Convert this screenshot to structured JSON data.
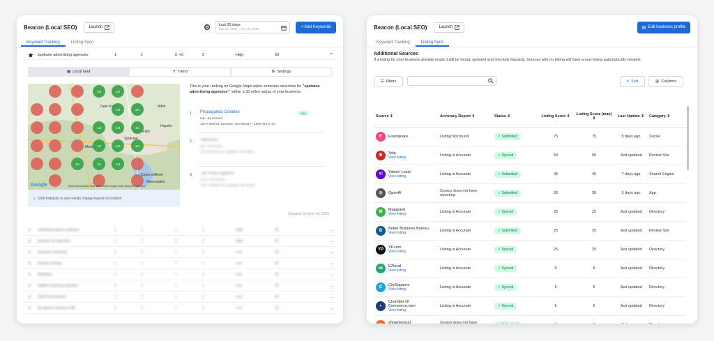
{
  "left": {
    "app_title": "Beacon (Local SEO)",
    "launch_label": "Launch",
    "date_range": "Last 30 days",
    "date_sub": "Sep 23, 2025 – Oct 23, 2025",
    "add_keywords_label": "+ Add Keywords",
    "tabs": [
      "Keyword Tracking",
      "Listing Sync"
    ],
    "keyword": {
      "name": "spokane advertising agencies",
      "c1": "1",
      "c2": "1",
      "c3": "5",
      "c3_change": "3",
      "c4": "2",
      "difficulty": "High",
      "volume": "90"
    },
    "map_tabs": [
      "Local Grid",
      "Trend",
      "Settings"
    ],
    "map": {
      "places": [
        "Deer Park",
        "Athol",
        "Hayden",
        "Post Falls",
        "Medical Lake",
        "Spokane",
        "Coeur d'Alene",
        "Reservation"
      ],
      "pin_label": "1st",
      "footer_text": "Click hotspots to see results change based on location",
      "attribution": "Keyboard shortcuts   Map data ©2025 Google   Terms   Report a map error"
    },
    "rank_description_pre": "This is your ranking on Google Maps when someone searches for ",
    "rank_description_keyword": "\"spokane advertising agencies\"",
    "rank_description_post": ", within a 30 miles radius of your business.",
    "results": [
      {
        "num": "1",
        "name": "Propaganda Creative",
        "rating": "5★ • 64 reviews",
        "address": "123 S Wall St, Spokane, WA 99201 • +1509-413-1719",
        "you": "You"
      },
      {
        "num": "2",
        "name": "Oblivision",
        "rating": "5★ • 42 reviews",
        "address": "721 N Monroe St, Spokane, WA 99201",
        "you": ""
      },
      {
        "num": "3",
        "name": "Tall Grass Agency",
        "rating": "4.9★ • 18 reviews",
        "address": "155 S Madison St, Spokane, WA 99201",
        "you": ""
      }
    ],
    "updated_text": "Updated October 18, 2025",
    "other_keywords": [
      {
        "name": "marketing agency spokane",
        "c1": "1",
        "c2": "1",
        "c3": "1",
        "c4": "1",
        "d": "High",
        "v": "90"
      },
      {
        "name": "spokane ad agencies",
        "c1": "1",
        "c2": "1",
        "c3": "4",
        "c4": "2",
        "d": "High",
        "v": "50"
      },
      {
        "name": "spokane marketing",
        "c1": "1",
        "c2": "1",
        "c3": "1",
        "c4": "1",
        "d": "Low",
        "v": "30"
      },
      {
        "name": "Graphic Design",
        "c1": "1",
        "c2": "1",
        "c3": "1",
        "c4": "1",
        "d": "Low",
        "v": "30"
      },
      {
        "name": "Branding",
        "c1": "1",
        "c2": "1",
        "c3": "1",
        "c4": "1",
        "d": "Low",
        "v": "30"
      },
      {
        "name": "Digital marketing Spokane",
        "c1": "4",
        "c2": "1",
        "c3": "1",
        "c4": "1",
        "d": "Low",
        "v": "30"
      },
      {
        "name": "Web Development",
        "c1": "1",
        "c2": "1",
        "c3": "1",
        "c4": "1",
        "d": "Low",
        "v": "30"
      },
      {
        "name": "Ad agency Spokane WA",
        "c1": "1",
        "c2": "1",
        "c3": "1",
        "c4": "1",
        "d": "Low",
        "v": "30"
      }
    ]
  },
  "right": {
    "app_title": "Beacon (Local SEO)",
    "launch_label": "Launch",
    "edit_profile_label": "Edit business profile",
    "tabs": [
      "Keyword Tracking",
      "Listing Sync"
    ],
    "section_title": "Additional Sources",
    "section_desc": "If a listing for your business already exists it will be found, updated and checked regularly. Sources with no listing will have a new listing automatically created.",
    "filters_label": "Filters",
    "search_placeholder": "",
    "sort_label": "Sort",
    "columns_label": "Columns",
    "headers": [
      "Source",
      "Accuracy Report",
      "Status",
      "Listing Score",
      "Listing Score (max)",
      "Last Update",
      "Category"
    ],
    "rows": [
      {
        "source": "Foursquare",
        "link": "",
        "accuracy": "Listing Not found",
        "status": "Submitted",
        "score": "75",
        "max": "75",
        "update": "5 days ago",
        "category": "Social",
        "color": "#f94877",
        "glyph": "F"
      },
      {
        "source": "Yelp",
        "link": "View listing",
        "accuracy": "Listing is Accurate",
        "status": "Synced",
        "score": "50",
        "max": "50",
        "update": "Just updated",
        "category": "Review Site",
        "color": "#d32323",
        "glyph": "✱"
      },
      {
        "source": "Yahoo! Local",
        "link": "View listing",
        "accuracy": "Listing is Accurate",
        "status": "Submitted",
        "score": "45",
        "max": "45",
        "update": "7 days ago",
        "category": "Search Engine",
        "color": "#6001d2",
        "glyph": "Y!"
      },
      {
        "source": "OpenAI",
        "link": "",
        "accuracy": "Source does not have reporting",
        "status": "Submitted",
        "score": "30",
        "max": "30",
        "update": "5 days ago",
        "category": "App",
        "color": "#555555",
        "glyph": "◎"
      },
      {
        "source": "Mapquest",
        "link": "View listing",
        "accuracy": "Listing is Accurate",
        "status": "Synced",
        "score": "25",
        "max": "25",
        "update": "Just updated",
        "category": "Directory",
        "color": "#3ab54a",
        "glyph": "M"
      },
      {
        "source": "Better Business Bureau",
        "link": "View listing",
        "accuracy": "Listing is Accurate",
        "status": "Submitted",
        "score": "25",
        "max": "25",
        "update": "Just updated",
        "category": "Review Site",
        "color": "#0d5b8f",
        "glyph": "B"
      },
      {
        "source": "YP.com",
        "link": "View listing",
        "accuracy": "Listing is Accurate",
        "status": "Synced",
        "score": "25",
        "max": "25",
        "update": "Just updated",
        "category": "Directory",
        "color": "#111111",
        "glyph": "YP"
      },
      {
        "source": "EZlocal",
        "link": "View listing",
        "accuracy": "Listing is Accurate",
        "status": "Synced",
        "score": "5",
        "max": "5",
        "update": "Just updated",
        "category": "Directory",
        "color": "#26a96c",
        "glyph": "ez"
      },
      {
        "source": "CitySquares",
        "link": "View listing",
        "accuracy": "Listing is Accurate",
        "status": "Synced",
        "score": "5",
        "max": "5",
        "update": "Just updated",
        "category": "Directory",
        "color": "#25a4dc",
        "glyph": "C"
      },
      {
        "source": "Chamber Of Commerce.com",
        "link": "View listing",
        "accuracy": "Listing is Accurate",
        "status": "Synced",
        "score": "5",
        "max": "5",
        "update": "Just updated",
        "category": "Directory",
        "color": "#1f3f7a",
        "glyph": "◐"
      },
      {
        "source": "showmelocal",
        "link": "View listing",
        "accuracy": "Source does not have reporting",
        "status": "Submitted",
        "score": "5",
        "max": "5",
        "update": "5 days ago",
        "category": "Directory",
        "color": "#f26b1d",
        "glyph": "◉"
      }
    ]
  }
}
